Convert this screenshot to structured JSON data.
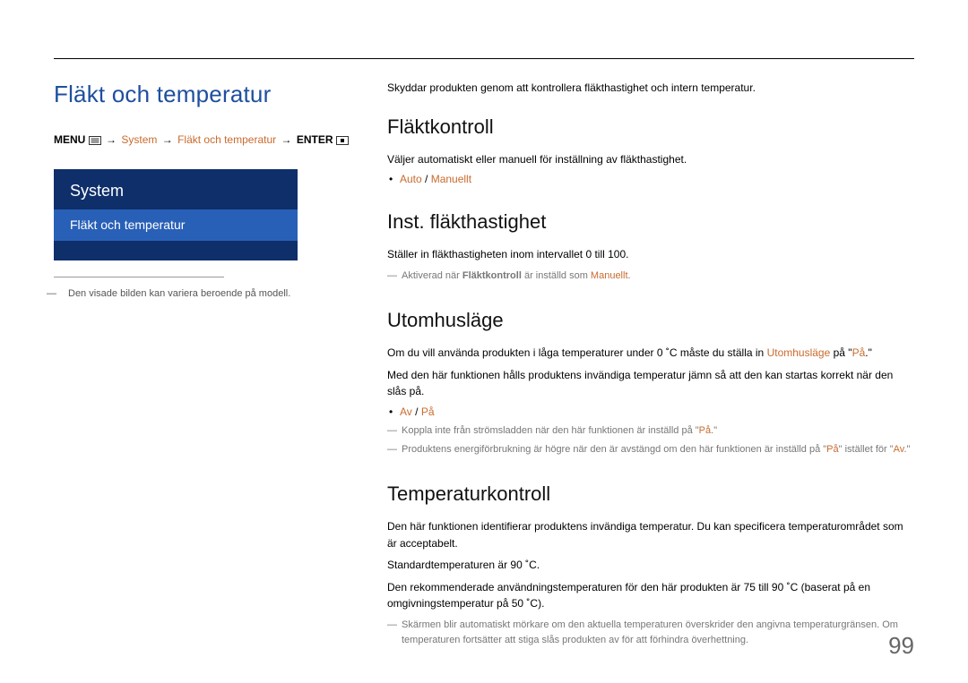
{
  "page_title": "Fläkt och temperatur",
  "breadcrumb": {
    "menu_label": "MENU",
    "arrow": "→",
    "part1": "System",
    "part2": "Fläkt och temperatur",
    "enter_label": "ENTER"
  },
  "panel": {
    "header": "System",
    "item": "Fläkt och temperatur"
  },
  "left_note": "Den visade bilden kan variera beroende på modell.",
  "intro": "Skyddar produkten genom att kontrollera fläkthastighet och intern temperatur.",
  "sections": {
    "flaktkontroll": {
      "heading": "Fläktkontroll",
      "desc": "Väljer automatiskt eller manuell för inställning av fläkthastighet.",
      "opt_a": "Auto",
      "opt_sep": " / ",
      "opt_b": "Manuellt"
    },
    "inst": {
      "heading": "Inst. fläkthastighet",
      "desc": "Ställer in fläkthastigheten inom intervallet 0 till 100.",
      "note_prefix": "Aktiverad när ",
      "note_bold": "Fläktkontroll",
      "note_mid": " är inställd som ",
      "note_orange": "Manuellt",
      "note_suffix": "."
    },
    "utom": {
      "heading": "Utomhusläge",
      "p1_a": "Om du vill använda produkten i låga temperaturer under 0 ˚C måste du ställa in ",
      "p1_orange1": "Utomhusläge",
      "p1_b": " på \"",
      "p1_orange2": "På",
      "p1_c": ".\"",
      "p2": "Med den här funktionen hålls produktens invändiga temperatur jämn så att den kan startas korrekt när den slås på.",
      "opt_a": "Av",
      "opt_sep": " / ",
      "opt_b": "På",
      "note1_a": "Koppla inte från strömsladden när den här funktionen är inställd på \"",
      "note1_orange": "På",
      "note1_b": ".\"",
      "note2_a": "Produktens energiförbrukning är högre när den är avstängd om den här funktionen är inställd på \"",
      "note2_orange1": "På",
      "note2_b": "\" istället för \"",
      "note2_orange2": "Av",
      "note2_c": ".\""
    },
    "temp": {
      "heading": "Temperaturkontroll",
      "p1": "Den här funktionen identifierar produktens invändiga temperatur. Du kan specificera temperaturområdet som är acceptabelt.",
      "p2": "Standardtemperaturen är 90 ˚C.",
      "p3": "Den rekommenderade användningstemperaturen för den här produkten är 75 till 90 ˚C (baserat på en omgivningstemperatur på 50 ˚C).",
      "note": "Skärmen blir automatiskt mörkare om den aktuella temperaturen överskrider den angivna temperaturgränsen. Om temperaturen fortsätter att stiga slås produkten av för att förhindra överhettning."
    }
  },
  "page_number": "99"
}
